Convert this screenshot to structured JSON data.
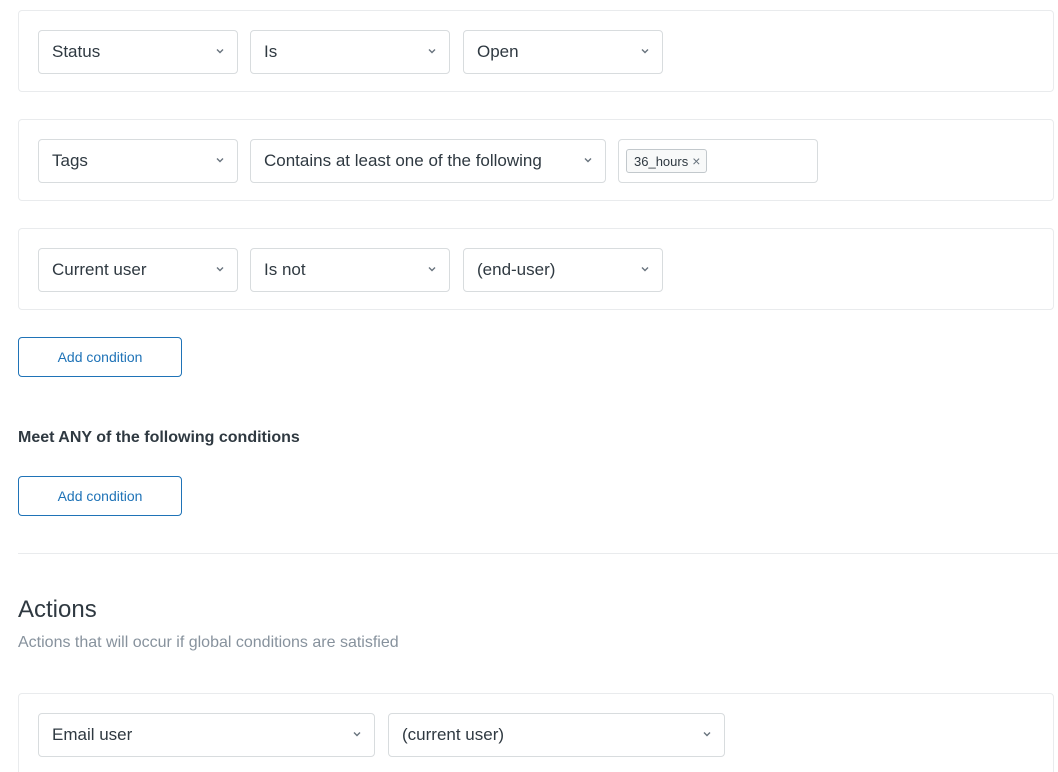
{
  "all_conditions": [
    {
      "field": "Status",
      "operator": "Is",
      "value": "Open"
    },
    {
      "field": "Tags",
      "operator": "Contains at least one of the following",
      "tags": [
        "36_hours"
      ]
    },
    {
      "field": "Current user",
      "operator": "Is not",
      "value": "(end-user)"
    }
  ],
  "add_condition_all_label": "Add condition",
  "any_section": {
    "heading": "Meet ANY of the following conditions",
    "add_condition_label": "Add condition"
  },
  "actions": {
    "title": "Actions",
    "subtitle": "Actions that will occur if global conditions are satisfied",
    "items": [
      {
        "action": "Email user",
        "target": "(current user)"
      }
    ]
  },
  "icons": {
    "select_chevron": "chevron-down-icon",
    "tag_remove": "close-icon"
  },
  "colors": {
    "accent": "#1f73b7",
    "border": "#d8dcde",
    "text": "#2f3941",
    "muted": "#87929d"
  }
}
